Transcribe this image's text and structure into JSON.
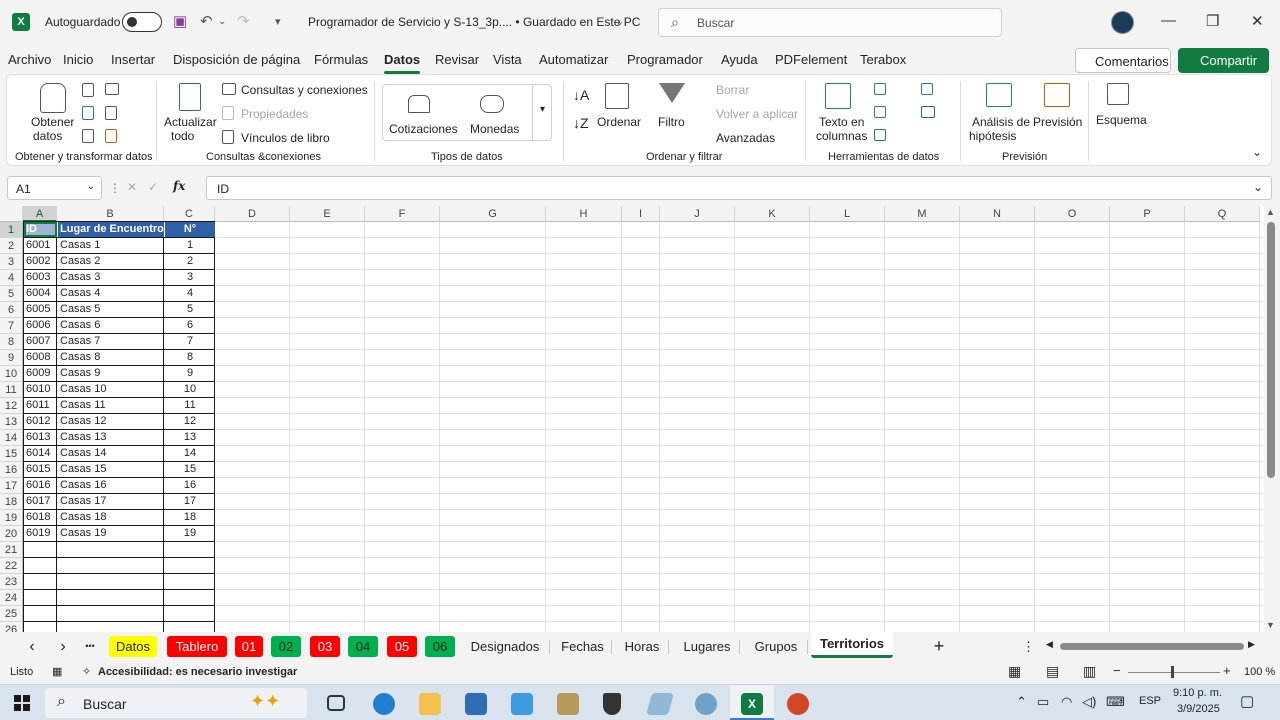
{
  "titlebar": {
    "autosave_label": "Autoguardado",
    "file_name": "Programador de Servicio y S-13_3p....  •  Guardado en Este PC",
    "search_placeholder": "Buscar"
  },
  "menu": {
    "tabs": [
      "Archivo",
      "Inicio",
      "Insertar",
      "Disposición de página",
      "Fórmulas",
      "Datos",
      "Revisar",
      "Vista",
      "Automatizar",
      "Programador",
      "Ayuda",
      "PDFelement",
      "Terabox"
    ],
    "active_tab": "Datos",
    "comments_label": "Comentarios",
    "share_label": "Compartir"
  },
  "ribbon": {
    "get_data_line1": "Obtener",
    "get_data_line2": "datos",
    "group1": "Obtener y transformar datos",
    "refresh_line1": "Actualizar",
    "refresh_line2": "todo",
    "queries": "Consultas y conexiones",
    "properties": "Propiedades",
    "links": "Vínculos de libro",
    "group2": "Consultas &conexiones",
    "quotes": "Cotizaciones",
    "currencies": "Monedas",
    "group3": "Tipos de datos",
    "sort": "Ordenar",
    "filter": "Filtro",
    "clear": "Borrar",
    "reapply": "Volver a aplicar",
    "advanced": "Avanzadas",
    "group4": "Ordenar y filtrar",
    "text_cols_line1": "Texto en",
    "text_cols_line2": "columnas",
    "group5": "Herramientas de datos",
    "whatif_line1": "Análisis de",
    "whatif_line2": "hipótesis",
    "forecast": "Previsión",
    "group6": "Previsión",
    "outline": "Esquema"
  },
  "formula_bar": {
    "cell_ref": "A1",
    "content": "ID"
  },
  "grid": {
    "columns": [
      "A",
      "B",
      "C",
      "D",
      "E",
      "F",
      "G",
      "H",
      "I",
      "J",
      "K",
      "L",
      "M",
      "N",
      "O",
      "P",
      "Q"
    ],
    "headers": [
      "ID",
      "Lugar de Encuentro",
      "N°"
    ],
    "rows": [
      [
        "6001",
        "Casas 1",
        "1"
      ],
      [
        "6002",
        "Casas 2",
        "2"
      ],
      [
        "6003",
        "Casas 3",
        "3"
      ],
      [
        "6004",
        "Casas 4",
        "4"
      ],
      [
        "6005",
        "Casas 5",
        "5"
      ],
      [
        "6006",
        "Casas 6",
        "6"
      ],
      [
        "6007",
        "Casas 7",
        "7"
      ],
      [
        "6008",
        "Casas 8",
        "8"
      ],
      [
        "6009",
        "Casas 9",
        "9"
      ],
      [
        "6010",
        "Casas 10",
        "10"
      ],
      [
        "6011",
        "Casas 11",
        "11"
      ],
      [
        "6012",
        "Casas 12",
        "12"
      ],
      [
        "6013",
        "Casas 13",
        "13"
      ],
      [
        "6014",
        "Casas 14",
        "14"
      ],
      [
        "6015",
        "Casas 15",
        "15"
      ],
      [
        "6016",
        "Casas 16",
        "16"
      ],
      [
        "6017",
        "Casas 17",
        "17"
      ],
      [
        "6018",
        "Casas 18",
        "18"
      ],
      [
        "6019",
        "Casas 19",
        "19"
      ]
    ],
    "row_numbers": [
      "1",
      "2",
      "3",
      "4",
      "5",
      "6",
      "7",
      "8",
      "9",
      "10",
      "11",
      "12",
      "13",
      "14",
      "15",
      "16",
      "17",
      "18",
      "19",
      "20",
      "21",
      "22",
      "23",
      "24",
      "25",
      "26"
    ]
  },
  "sheets": {
    "colored": [
      {
        "label": "Datos",
        "bg": "#ffff00",
        "fg": "#242424"
      },
      {
        "label": "Tablero",
        "bg": "#ff0000",
        "fg": "#ffffff"
      },
      {
        "label": "01",
        "bg": "#ff0000",
        "fg": "#ffffff"
      },
      {
        "label": "02",
        "bg": "#00b050",
        "fg": "#242424"
      },
      {
        "label": "03",
        "bg": "#ff0000",
        "fg": "#ffffff"
      },
      {
        "label": "04",
        "bg": "#00b050",
        "fg": "#242424"
      },
      {
        "label": "05",
        "bg": "#ff0000",
        "fg": "#ffffff"
      },
      {
        "label": "06",
        "bg": "#00b050",
        "fg": "#242424"
      }
    ],
    "plain": [
      "Designados",
      "Fechas",
      "Horas",
      "Lugares",
      "Grupos"
    ],
    "active": "Territorios"
  },
  "status": {
    "ready": "Listo",
    "accessibility": "Accesibilidad: es necesario investigar",
    "zoom": "100 %"
  },
  "taskbar": {
    "search": "Buscar",
    "lang": "ESP",
    "time": "9:10 p. m.",
    "date": "3/9/2025"
  }
}
